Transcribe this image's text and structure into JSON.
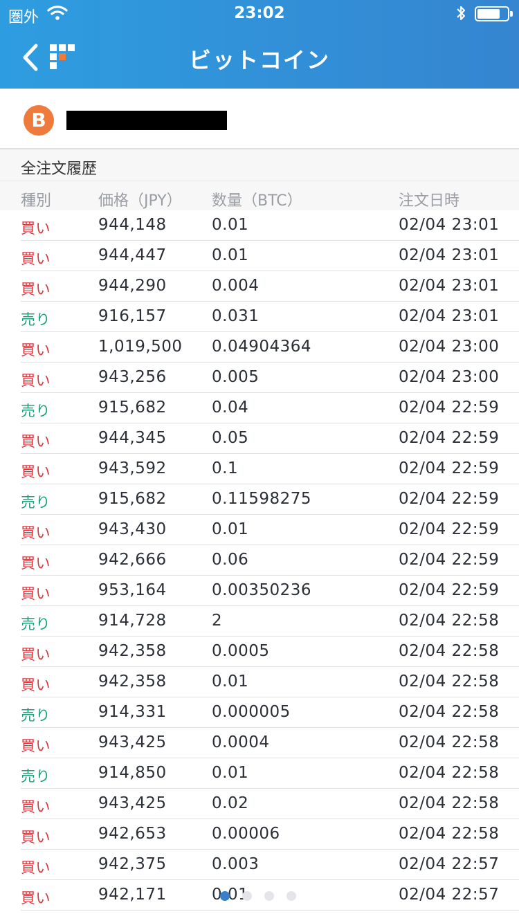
{
  "status_bar": {
    "carrier": "圏外",
    "time": "23:02"
  },
  "header": {
    "title": "ビットコイン"
  },
  "coin": {
    "symbol": "B",
    "icon_color": "#ee7b3b"
  },
  "section": {
    "title": "全注文履歴"
  },
  "columns": {
    "type": "種別",
    "price": "価格（JPY）",
    "qty": "数量（BTC）",
    "date": "注文日時"
  },
  "colors": {
    "buy": "#d9363e",
    "sell": "#1aa37a",
    "header_start": "#2e9de0",
    "header_end": "#3585d0"
  },
  "orders": [
    {
      "type": "買い",
      "side": "buy",
      "price": "944,148",
      "qty": "0.01",
      "date": "02/04 23:01"
    },
    {
      "type": "買い",
      "side": "buy",
      "price": "944,447",
      "qty": "0.01",
      "date": "02/04 23:01"
    },
    {
      "type": "買い",
      "side": "buy",
      "price": "944,290",
      "qty": "0.004",
      "date": "02/04 23:01"
    },
    {
      "type": "売り",
      "side": "sell",
      "price": "916,157",
      "qty": "0.031",
      "date": "02/04 23:01"
    },
    {
      "type": "買い",
      "side": "buy",
      "price": "1,019,500",
      "qty": "0.04904364",
      "date": "02/04 23:00"
    },
    {
      "type": "買い",
      "side": "buy",
      "price": "943,256",
      "qty": "0.005",
      "date": "02/04 23:00"
    },
    {
      "type": "売り",
      "side": "sell",
      "price": "915,682",
      "qty": "0.04",
      "date": "02/04 22:59"
    },
    {
      "type": "買い",
      "side": "buy",
      "price": "944,345",
      "qty": "0.05",
      "date": "02/04 22:59"
    },
    {
      "type": "買い",
      "side": "buy",
      "price": "943,592",
      "qty": "0.1",
      "date": "02/04 22:59"
    },
    {
      "type": "売り",
      "side": "sell",
      "price": "915,682",
      "qty": "0.11598275",
      "date": "02/04 22:59"
    },
    {
      "type": "買い",
      "side": "buy",
      "price": "943,430",
      "qty": "0.01",
      "date": "02/04 22:59"
    },
    {
      "type": "買い",
      "side": "buy",
      "price": "942,666",
      "qty": "0.06",
      "date": "02/04 22:59"
    },
    {
      "type": "買い",
      "side": "buy",
      "price": "953,164",
      "qty": "0.00350236",
      "date": "02/04 22:59"
    },
    {
      "type": "売り",
      "side": "sell",
      "price": "914,728",
      "qty": "2",
      "date": "02/04 22:58"
    },
    {
      "type": "買い",
      "side": "buy",
      "price": "942,358",
      "qty": "0.0005",
      "date": "02/04 22:58"
    },
    {
      "type": "買い",
      "side": "buy",
      "price": "942,358",
      "qty": "0.01",
      "date": "02/04 22:58"
    },
    {
      "type": "売り",
      "side": "sell",
      "price": "914,331",
      "qty": "0.000005",
      "date": "02/04 22:58"
    },
    {
      "type": "買い",
      "side": "buy",
      "price": "943,425",
      "qty": "0.0004",
      "date": "02/04 22:58"
    },
    {
      "type": "売り",
      "side": "sell",
      "price": "914,850",
      "qty": "0.01",
      "date": "02/04 22:58"
    },
    {
      "type": "買い",
      "side": "buy",
      "price": "943,425",
      "qty": "0.02",
      "date": "02/04 22:58"
    },
    {
      "type": "買い",
      "side": "buy",
      "price": "942,653",
      "qty": "0.00006",
      "date": "02/04 22:58"
    },
    {
      "type": "買い",
      "side": "buy",
      "price": "942,375",
      "qty": "0.003",
      "date": "02/04 22:57"
    },
    {
      "type": "買い",
      "side": "buy",
      "price": "942,171",
      "qty": "0.01",
      "date": "02/04 22:57"
    }
  ],
  "pager": {
    "count": 4,
    "active": 0
  }
}
